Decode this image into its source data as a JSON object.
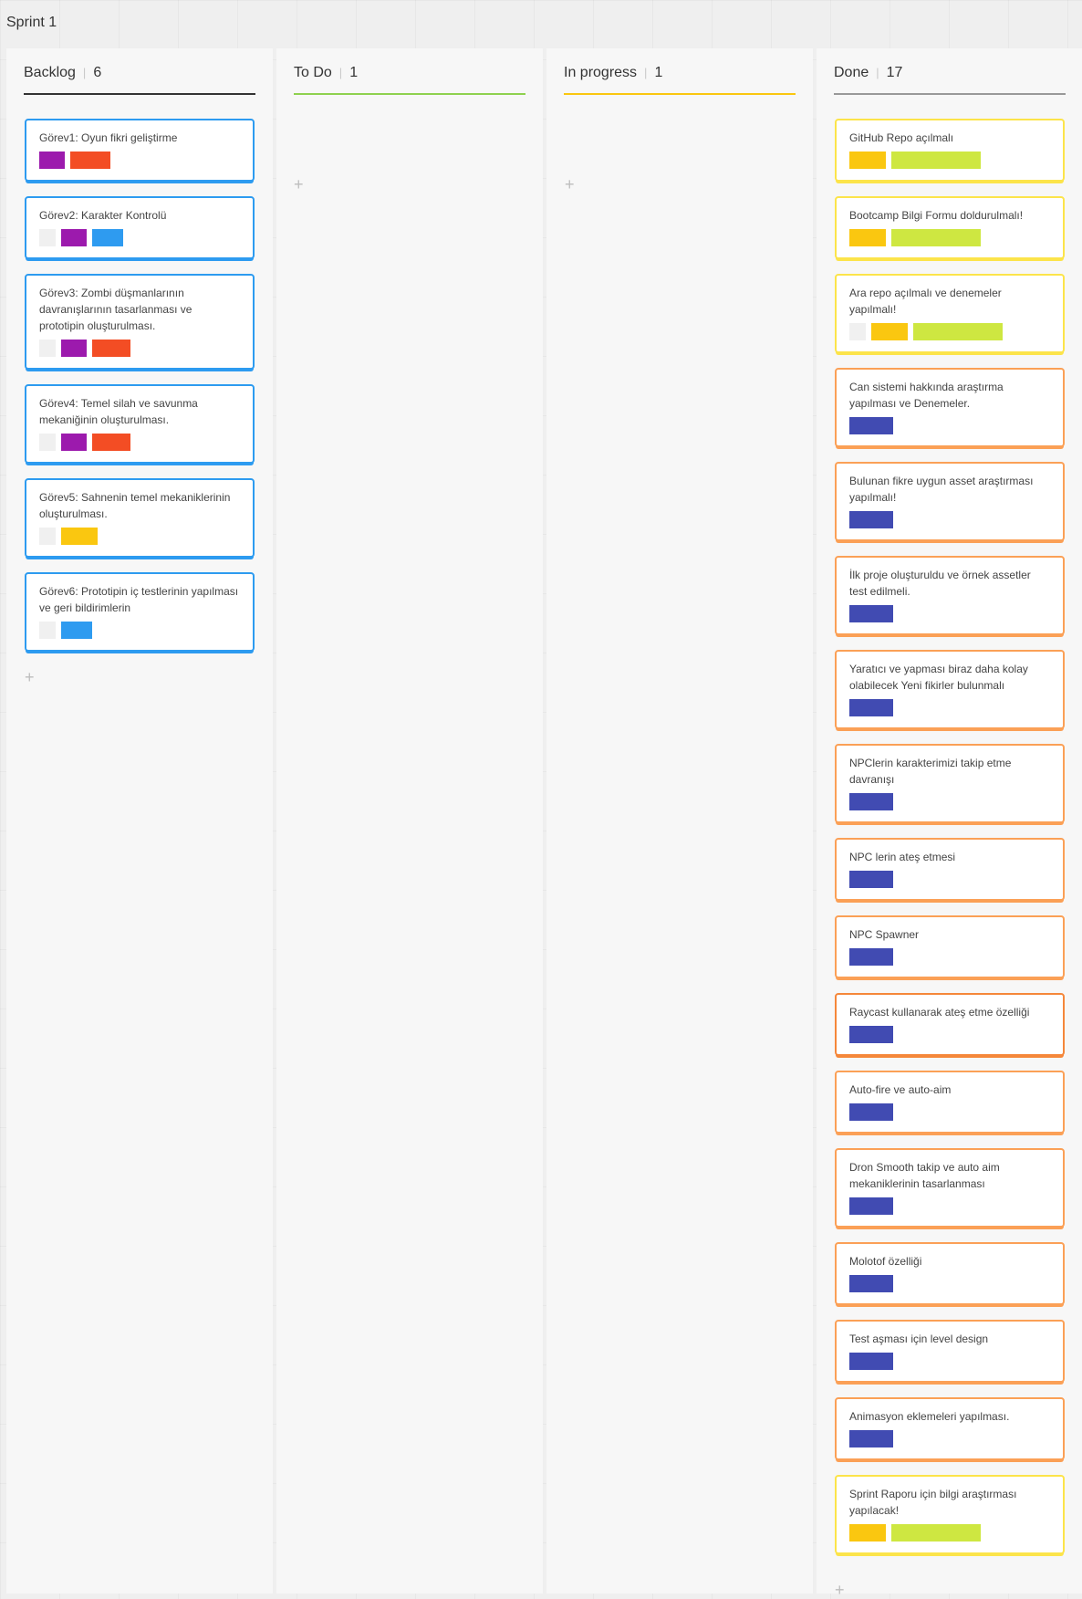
{
  "frame": {
    "title": "Sprint 1"
  },
  "columns": [
    {
      "id": "backlog",
      "name": "Backlog",
      "count": "6",
      "line_color": "#333333",
      "card_border": "#2d9bf0",
      "cards": [
        {
          "text": "Görev1: Oyun fikri geliştirme",
          "tags": [
            "#9c1aad",
            "#f34d24"
          ]
        },
        {
          "text": "Görev2: Karakter Kontrolü",
          "tags": [
            "#f0f0f0",
            "#9c1aad",
            "#2e9bf0"
          ]
        },
        {
          "text": "Görev3: Zombi düşmanlarının davranışlarının tasarlanması ve prototipin oluşturulması.",
          "tags": [
            "#f0f0f0",
            "#9c1aad",
            "#f34d24"
          ]
        },
        {
          "text": "Görev4: Temel silah ve savunma mekaniğinin oluşturulması.",
          "tags": [
            "#f0f0f0",
            "#9c1aad",
            "#f34d24"
          ]
        },
        {
          "text": "Görev5: Sahnenin temel mekaniklerinin oluşturulması.",
          "tags": [
            "#f0f0f0",
            "#fac710"
          ]
        },
        {
          "text": "Görev6: Prototipin iç testlerinin yapılması ve geri bildirimlerin",
          "tags": [
            "#f0f0f0",
            "#2e9bf0"
          ]
        }
      ]
    },
    {
      "id": "todo",
      "name": "To Do",
      "count": "1",
      "line_color": "#8fd14f",
      "card_border": "#2d9bf0",
      "cards": []
    },
    {
      "id": "in-progress",
      "name": "In progress",
      "count": "1",
      "line_color": "#fac710",
      "card_border": "#2d9bf0",
      "cards": []
    },
    {
      "id": "done",
      "name": "Done",
      "count": "17",
      "line_color": "#999999",
      "card_border": "#fac710",
      "cards": [
        {
          "text": "GitHub Repo açılmalı",
          "tags": [
            "#fac710",
            "#cee741"
          ],
          "border": "#fce44a"
        },
        {
          "text": "Bootcamp Bilgi Formu doldurulmalı!",
          "tags": [
            "#fac710",
            "#cee741"
          ],
          "border": "#fce44a"
        },
        {
          "text": "Ara repo açılmalı ve denemeler yapılmalı!",
          "tags": [
            "#f0f0f0",
            "#fac710",
            "#cee741"
          ],
          "border": "#fce44a"
        },
        {
          "text": "Can sistemi hakkında araştırma yapılması ve Denemeler.",
          "tags": [
            "#414bb2"
          ],
          "border": "#fba056"
        },
        {
          "text": "Bulunan fikre uygun asset araştırması yapılmalı!",
          "tags": [
            "#414bb2"
          ],
          "border": "#fba056"
        },
        {
          "text": "İlk proje oluşturuldu ve örnek assetler test edilmeli.",
          "tags": [
            "#414bb2"
          ],
          "border": "#fba056"
        },
        {
          "text": "Yaratıcı ve yapması biraz daha kolay olabilecek Yeni fikirler bulunmalı",
          "tags": [
            "#414bb2"
          ],
          "border": "#fba056"
        },
        {
          "text": "NPClerin karakterimizi takip etme davranışı",
          "tags": [
            "#414bb2"
          ],
          "border": "#fba056"
        },
        {
          "text": "NPC lerin ateş etmesi",
          "tags": [
            "#414bb2"
          ],
          "border": "#fba056"
        },
        {
          "text": "NPC Spawner",
          "tags": [
            "#414bb2"
          ],
          "border": "#fba056"
        },
        {
          "text": "Raycast kullanarak ateş etme özelliği",
          "tags": [
            "#414bb2"
          ],
          "border": "#f5873a"
        },
        {
          "text": "Auto-fire ve auto-aim",
          "tags": [
            "#414bb2"
          ],
          "border": "#fba056"
        },
        {
          "text": "Dron Smooth takip ve auto aim mekaniklerinin tasarlanması",
          "tags": [
            "#414bb2"
          ],
          "border": "#fba056"
        },
        {
          "text": "Molotof özelliği",
          "tags": [
            "#414bb2"
          ],
          "border": "#fba056"
        },
        {
          "text": "Test aşması için level design",
          "tags": [
            "#414bb2"
          ],
          "border": "#fba056"
        },
        {
          "text": "Animasyon eklemeleri yapılması.",
          "tags": [
            "#414bb2"
          ],
          "border": "#fba056"
        },
        {
          "text": "Sprint Raporu için bilgi araştırması yapılacak!",
          "tags": [
            "#fac710",
            "#cee741"
          ],
          "border": "#fce44a"
        }
      ]
    }
  ],
  "add_icon_glyph": "+"
}
